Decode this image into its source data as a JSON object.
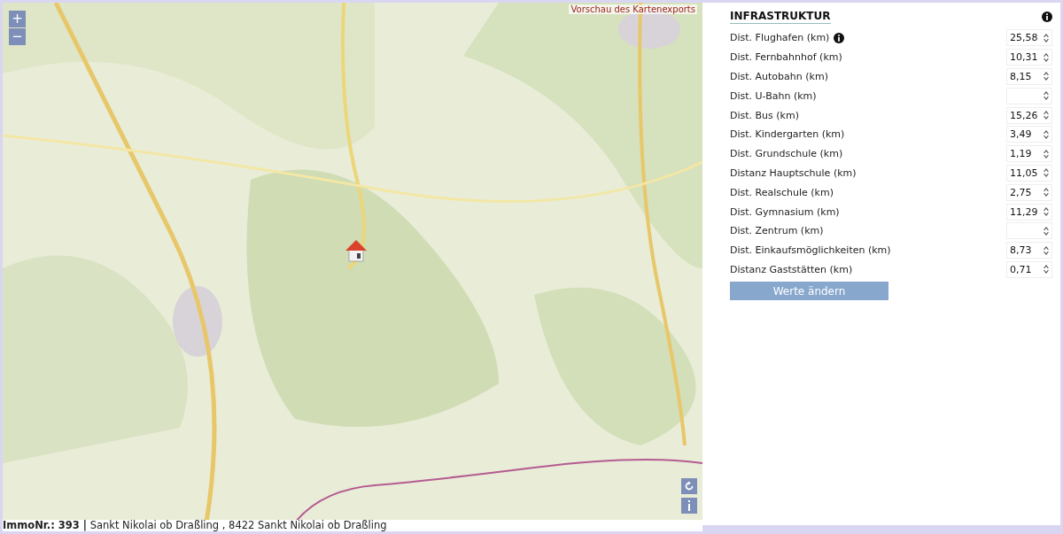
{
  "map": {
    "export_label": "Vorschau des Kartenexports",
    "zoom_in": "+",
    "zoom_out": "−"
  },
  "caption": "**ImmoNr.: 393 |** Sankt Nikolai ob Draßling , 8422 Sankt Nikolai ob Draßling",
  "panel": {
    "title": "INFRASTRUKTUR",
    "rows": [
      {
        "label": "Dist. Flughafen (km)",
        "value": "25,58",
        "info": true
      },
      {
        "label": "Dist. Fernbahnhof (km)",
        "value": "10,31",
        "info": false
      },
      {
        "label": "Dist. Autobahn (km)",
        "value": "8,15",
        "info": false
      },
      {
        "label": "Dist. U-Bahn (km)",
        "info": false
      },
      {
        "label": "Dist. Bus (km)",
        "value": "15,26",
        "info": false
      },
      {
        "label": "Dist. Kindergarten (km)",
        "value": "3,49",
        "info": false
      },
      {
        "label": "Dist. Grundschule (km)",
        "value": "1,19",
        "info": false
      },
      {
        "label": "Distanz Hauptschule (km)",
        "value": "11,05",
        "info": false
      },
      {
        "label": "Dist. Realschule (km)",
        "value": "2,75",
        "info": false
      },
      {
        "label": "Dist. Gymnasium (km)",
        "value": "11,29",
        "info": false
      },
      {
        "label": "Dist. Zentrum (km)",
        "info": false
      },
      {
        "label": "Dist. Einkaufsmöglichkeiten (km)",
        "value": "8,73",
        "info": false
      },
      {
        "label": "Distanz Gaststätten (km)",
        "value": "0,71",
        "info": false
      }
    ],
    "button": "Werte ändern"
  }
}
